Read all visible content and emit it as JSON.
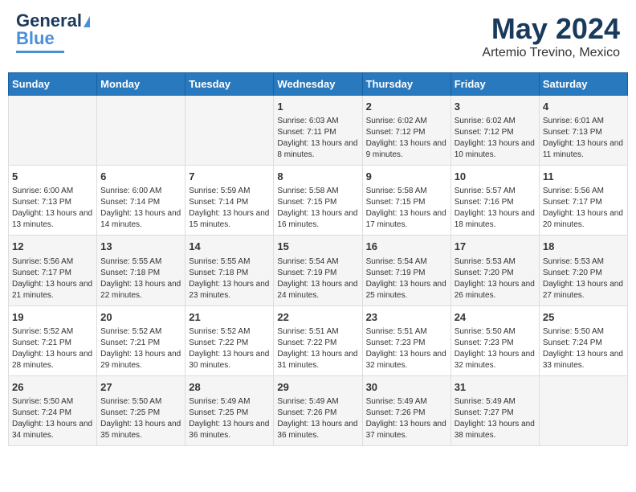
{
  "header": {
    "logo_line1": "General",
    "logo_line2": "Blue",
    "title": "May 2024",
    "subtitle": "Artemio Trevino, Mexico"
  },
  "days_of_week": [
    "Sunday",
    "Monday",
    "Tuesday",
    "Wednesday",
    "Thursday",
    "Friday",
    "Saturday"
  ],
  "weeks": [
    [
      {
        "day": "",
        "info": ""
      },
      {
        "day": "",
        "info": ""
      },
      {
        "day": "",
        "info": ""
      },
      {
        "day": "1",
        "info": "Sunrise: 6:03 AM\nSunset: 7:11 PM\nDaylight: 13 hours and 8 minutes."
      },
      {
        "day": "2",
        "info": "Sunrise: 6:02 AM\nSunset: 7:12 PM\nDaylight: 13 hours and 9 minutes."
      },
      {
        "day": "3",
        "info": "Sunrise: 6:02 AM\nSunset: 7:12 PM\nDaylight: 13 hours and 10 minutes."
      },
      {
        "day": "4",
        "info": "Sunrise: 6:01 AM\nSunset: 7:13 PM\nDaylight: 13 hours and 11 minutes."
      }
    ],
    [
      {
        "day": "5",
        "info": "Sunrise: 6:00 AM\nSunset: 7:13 PM\nDaylight: 13 hours and 13 minutes."
      },
      {
        "day": "6",
        "info": "Sunrise: 6:00 AM\nSunset: 7:14 PM\nDaylight: 13 hours and 14 minutes."
      },
      {
        "day": "7",
        "info": "Sunrise: 5:59 AM\nSunset: 7:14 PM\nDaylight: 13 hours and 15 minutes."
      },
      {
        "day": "8",
        "info": "Sunrise: 5:58 AM\nSunset: 7:15 PM\nDaylight: 13 hours and 16 minutes."
      },
      {
        "day": "9",
        "info": "Sunrise: 5:58 AM\nSunset: 7:15 PM\nDaylight: 13 hours and 17 minutes."
      },
      {
        "day": "10",
        "info": "Sunrise: 5:57 AM\nSunset: 7:16 PM\nDaylight: 13 hours and 18 minutes."
      },
      {
        "day": "11",
        "info": "Sunrise: 5:56 AM\nSunset: 7:17 PM\nDaylight: 13 hours and 20 minutes."
      }
    ],
    [
      {
        "day": "12",
        "info": "Sunrise: 5:56 AM\nSunset: 7:17 PM\nDaylight: 13 hours and 21 minutes."
      },
      {
        "day": "13",
        "info": "Sunrise: 5:55 AM\nSunset: 7:18 PM\nDaylight: 13 hours and 22 minutes."
      },
      {
        "day": "14",
        "info": "Sunrise: 5:55 AM\nSunset: 7:18 PM\nDaylight: 13 hours and 23 minutes."
      },
      {
        "day": "15",
        "info": "Sunrise: 5:54 AM\nSunset: 7:19 PM\nDaylight: 13 hours and 24 minutes."
      },
      {
        "day": "16",
        "info": "Sunrise: 5:54 AM\nSunset: 7:19 PM\nDaylight: 13 hours and 25 minutes."
      },
      {
        "day": "17",
        "info": "Sunrise: 5:53 AM\nSunset: 7:20 PM\nDaylight: 13 hours and 26 minutes."
      },
      {
        "day": "18",
        "info": "Sunrise: 5:53 AM\nSunset: 7:20 PM\nDaylight: 13 hours and 27 minutes."
      }
    ],
    [
      {
        "day": "19",
        "info": "Sunrise: 5:52 AM\nSunset: 7:21 PM\nDaylight: 13 hours and 28 minutes."
      },
      {
        "day": "20",
        "info": "Sunrise: 5:52 AM\nSunset: 7:21 PM\nDaylight: 13 hours and 29 minutes."
      },
      {
        "day": "21",
        "info": "Sunrise: 5:52 AM\nSunset: 7:22 PM\nDaylight: 13 hours and 30 minutes."
      },
      {
        "day": "22",
        "info": "Sunrise: 5:51 AM\nSunset: 7:22 PM\nDaylight: 13 hours and 31 minutes."
      },
      {
        "day": "23",
        "info": "Sunrise: 5:51 AM\nSunset: 7:23 PM\nDaylight: 13 hours and 32 minutes."
      },
      {
        "day": "24",
        "info": "Sunrise: 5:50 AM\nSunset: 7:23 PM\nDaylight: 13 hours and 32 minutes."
      },
      {
        "day": "25",
        "info": "Sunrise: 5:50 AM\nSunset: 7:24 PM\nDaylight: 13 hours and 33 minutes."
      }
    ],
    [
      {
        "day": "26",
        "info": "Sunrise: 5:50 AM\nSunset: 7:24 PM\nDaylight: 13 hours and 34 minutes."
      },
      {
        "day": "27",
        "info": "Sunrise: 5:50 AM\nSunset: 7:25 PM\nDaylight: 13 hours and 35 minutes."
      },
      {
        "day": "28",
        "info": "Sunrise: 5:49 AM\nSunset: 7:25 PM\nDaylight: 13 hours and 36 minutes."
      },
      {
        "day": "29",
        "info": "Sunrise: 5:49 AM\nSunset: 7:26 PM\nDaylight: 13 hours and 36 minutes."
      },
      {
        "day": "30",
        "info": "Sunrise: 5:49 AM\nSunset: 7:26 PM\nDaylight: 13 hours and 37 minutes."
      },
      {
        "day": "31",
        "info": "Sunrise: 5:49 AM\nSunset: 7:27 PM\nDaylight: 13 hours and 38 minutes."
      },
      {
        "day": "",
        "info": ""
      }
    ]
  ]
}
